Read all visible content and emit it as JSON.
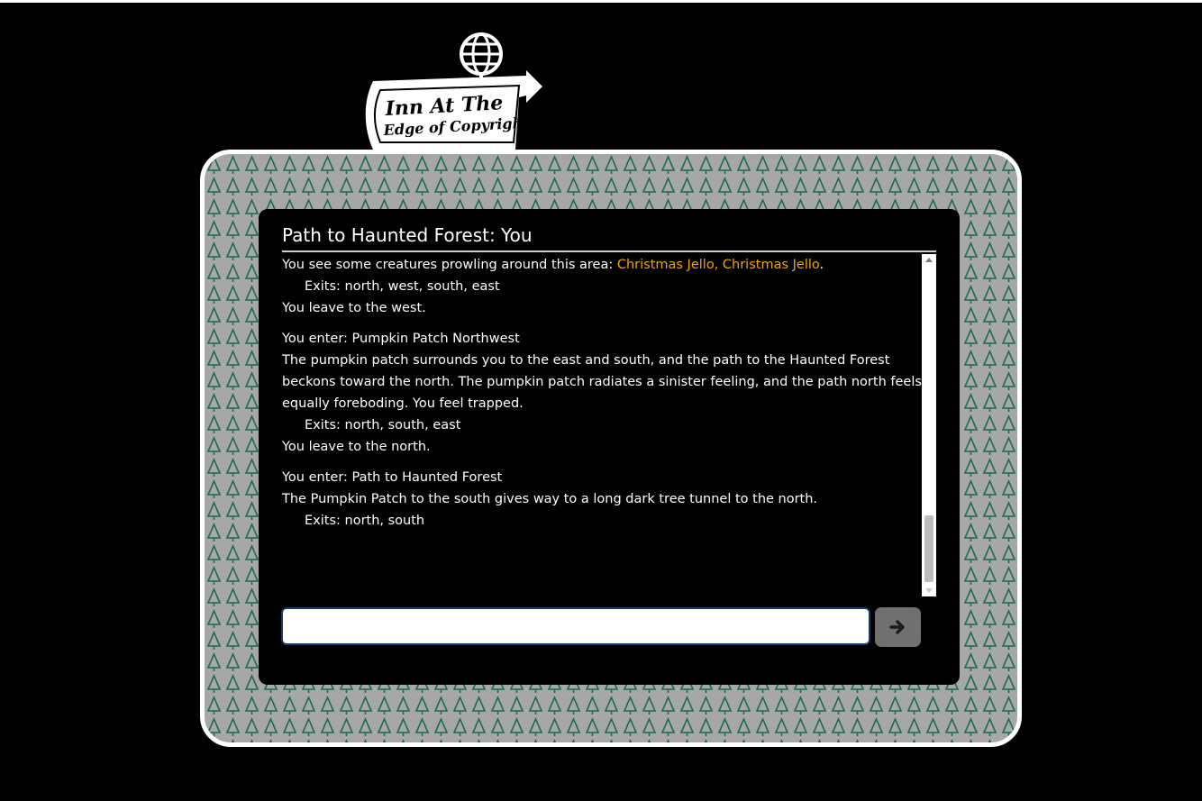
{
  "logo": {
    "line1": "Inn At The",
    "line2": "Edge of Copyright",
    "icon": "globe-icon"
  },
  "room": {
    "title": "Path to Haunted Forest: You"
  },
  "log": [
    {
      "type": "creatures",
      "prefix": "You see some creatures prowling around this area: ",
      "names": "Christmas Jello, Christmas Jello",
      "suffix": "."
    },
    {
      "type": "exits",
      "text": "Exits: north, west, south, east"
    },
    {
      "type": "text",
      "text": "You leave to the west."
    },
    {
      "type": "enter",
      "text": "You enter: Pumpkin Patch Northwest"
    },
    {
      "type": "text",
      "text": "The pumpkin patch surrounds you to the east and south, and the path to the Haunted Forest beckons toward the north. The pumpkin patch radiates a sinister feeling, and the path north feels equally foreboding. You feel trapped."
    },
    {
      "type": "exits",
      "text": "Exits: north, south, east"
    },
    {
      "type": "text",
      "text": "You leave to the north."
    },
    {
      "type": "enter",
      "text": "You enter: Path to Haunted Forest"
    },
    {
      "type": "text",
      "text": "The Pumpkin Patch to the south gives way to a long dark tree tunnel to the north."
    },
    {
      "type": "exits",
      "text": "Exits: north, south"
    }
  ],
  "command": {
    "value": "",
    "placeholder": "",
    "send_icon": "arrow-right-icon"
  },
  "colors": {
    "background": "#000000",
    "frame_border": "#ffffff",
    "pattern_bg": "#a7a7a7",
    "tree_green": "#1f6b4e",
    "creature_highlight": "#f0a500",
    "input_border": "#0f3c6b",
    "send_button": "#707070"
  }
}
